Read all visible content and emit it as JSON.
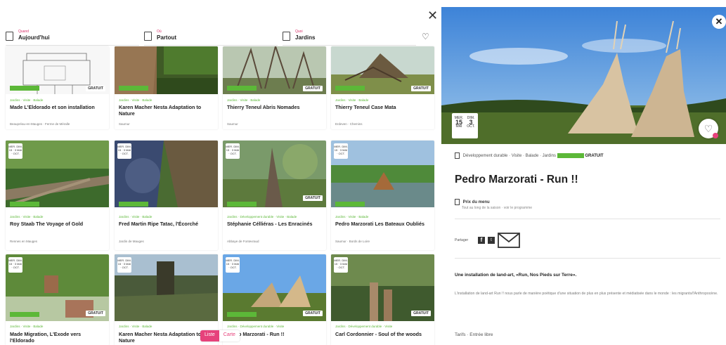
{
  "colors": {
    "accent": "#e6427b",
    "free_green": "#5cb838"
  },
  "left_panel": {
    "close_icon": "close-icon",
    "filters": [
      {
        "small": "Quand",
        "value": "Aujourd'hui",
        "icon": "calendar-icon"
      },
      {
        "small": "Où",
        "value": "Partout",
        "icon": "bookmark-icon"
      },
      {
        "small": "Quoi",
        "value": "Jardins",
        "icon": "bookmark-icon"
      }
    ],
    "favorites_icon": "heart-outline-icon",
    "cards": [
      {
        "cats": "Jardins · Visite · Balade",
        "title": "Made L'Eldorado et son installation",
        "place": "Beaupréau-en-Mauges · Ferme de Méralle",
        "free": true,
        "gratuit": "GRATUIT",
        "date": ""
      },
      {
        "cats": "Jardins · Visite · Balade",
        "title": "Karen Macher Nesta Adaptation to Nature",
        "place": "Saumur",
        "free": true,
        "gratuit": "",
        "date": ""
      },
      {
        "cats": "Jardins · Visite · Balade",
        "title": "Thierry Teneul Abris Nomades",
        "place": "Saumur",
        "free": true,
        "gratuit": "GRATUIT",
        "date": ""
      },
      {
        "cats": "Jardins · Visite · Balade",
        "title": "Thierry Teneul Case Mata",
        "place": "Erdeven · Chemins",
        "free": true,
        "gratuit": "GRATUIT",
        "date": ""
      },
      {
        "cats": "Jardins · Visite · Balade",
        "title": "Roy Staab The Voyage of Gold",
        "place": "Rennes en Mauges",
        "free": true,
        "gratuit": "",
        "date": "MER. DIM. 15 · 3 MAI · OCT."
      },
      {
        "cats": "Jardins · Visite · Balade",
        "title": "Fred Martin Ripe Tatac, l'Écorché",
        "place": "Jardin de Mauges",
        "free": true,
        "gratuit": "",
        "date": "MER. DIM. 15 · 3 MAI · OCT."
      },
      {
        "cats": "Jardins · Développement durable · Visite · Balade",
        "title": "Stéphanie Célliéras - Les Enracinés",
        "place": "Abbaye de Fontevraud",
        "free": true,
        "gratuit": "GRATUIT",
        "date": "MER. DIM. 15 · 3 MAI · OCT."
      },
      {
        "cats": "Jardins · Visite · Balade",
        "title": "Pedro Marzorati Les Bateaux Oubliés",
        "place": "Saumur · Bords de Loire",
        "free": true,
        "gratuit": "",
        "date": "MER. DIM. 15 · 3 MAI · OCT."
      },
      {
        "cats": "Jardins · Visite · Balade",
        "title": "Made Migration, L'Exode vers l'Eldorado",
        "place": "",
        "free": true,
        "gratuit": "GRATUIT",
        "date": "MER. DIM. 15 · 3 MAI · OCT."
      },
      {
        "cats": "Jardins · Visite · Balade",
        "title": "Karen Macher Nesta Adaptation to Nature",
        "place": "",
        "free": false,
        "gratuit": "",
        "date": "MER. DIM. 15 · 3 MAI · OCT."
      },
      {
        "cats": "Jardins · Développement durable · Visite",
        "title": "Pedro Marzorati - Run !!",
        "place": "",
        "free": true,
        "gratuit": "GRATUIT",
        "date": "MER. DIM. 15 · 3 MAI · OCT."
      },
      {
        "cats": "Jardins · Développement durable · Visite",
        "title": "Carl Cordonnier - Soul of the woods",
        "place": "",
        "free": false,
        "gratuit": "GRATUIT",
        "date": "MER. DIM. 15 · 3 MAI · OCT."
      }
    ],
    "view_toggle": {
      "list": "Liste",
      "map": "Carte"
    }
  },
  "detail": {
    "close_icon": "close-icon",
    "date": {
      "d1_label": "MER.",
      "d1": "15",
      "d1_month": "MAI",
      "d2_label": "DIM.",
      "d2": "3",
      "d2_month": "OCT."
    },
    "fav_icon": "heart-plus-icon",
    "meta": "Développement durable · Visite · Balade · Jardins",
    "free_tag": "",
    "gratuit": "GRATUIT",
    "title": "Pedro Marzorati - Run !!",
    "price_label": "Prix du menu",
    "price_sub": "Tout au long de la saison · voir le programme",
    "share_label": "Partager",
    "intro": "Une installation de land-art, «Run, Nos Pieds sur Terre».",
    "description": "L'installation de land-art Run !! nous parle de manière poétique d'une situation de plus en plus présente et médiatisée dans le monde : les migrants/l'Anthropocène.",
    "tarifs": "Tarifs · Entrée libre"
  }
}
